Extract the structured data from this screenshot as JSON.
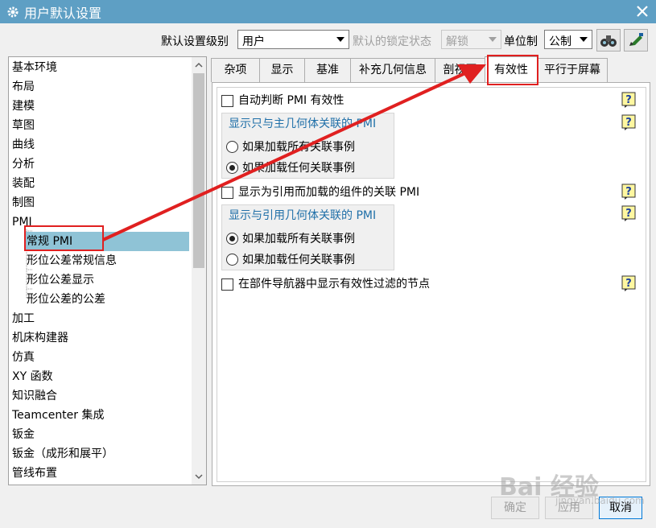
{
  "window": {
    "title": "用户默认设置",
    "accent": "#5e9fc4"
  },
  "toolbar": {
    "level_label": "默认设置级别",
    "level_value": "用户",
    "lock_label": "默认的锁定状态",
    "lock_value": "解锁",
    "unit_label": "单位制",
    "unit_value": "公制"
  },
  "tree": {
    "items": [
      "基本环境",
      "布局",
      "建模",
      "草图",
      "曲线",
      "分析",
      "装配",
      "制图",
      "PMI",
      "常规 PMI",
      "形位公差常规信息",
      "形位公差显示",
      "形位公差的公差",
      "加工",
      "机床构建器",
      "仿真",
      "XY 函数",
      "知识融合",
      "Teamcenter 集成",
      "钣金",
      "钣金（成形和展平）",
      "管线布置"
    ]
  },
  "tabs": [
    "杂项",
    "显示",
    "基准",
    "补充几何信息",
    "剖视图",
    "有效性",
    "平行于屏幕"
  ],
  "content": {
    "auto_pmi": "自动判断 PMI 有效性",
    "group1_title": "显示只与主几何体关联的 PMI",
    "group1_opt1": "如果加载所有关联事例",
    "group1_opt2": "如果加载任何关联事例",
    "show_ref": "显示为引用而加载的组件的关联 PMI",
    "group2_title": "显示与引用几何体关联的 PMI",
    "group2_opt1": "如果加载所有关联事例",
    "group2_opt2": "如果加载任何关联事例",
    "nav_filter": "在部件导航器中显示有效性过滤的节点"
  },
  "buttons": {
    "ok": "确定",
    "apply": "应用",
    "cancel": "取消"
  },
  "watermark": {
    "text": "Bai 经验",
    "sub": "jingyan.baidu.com"
  },
  "colors": {
    "selection": "#8fc3d6",
    "highlight": "#e02020",
    "group_title": "#1f6fa8"
  }
}
